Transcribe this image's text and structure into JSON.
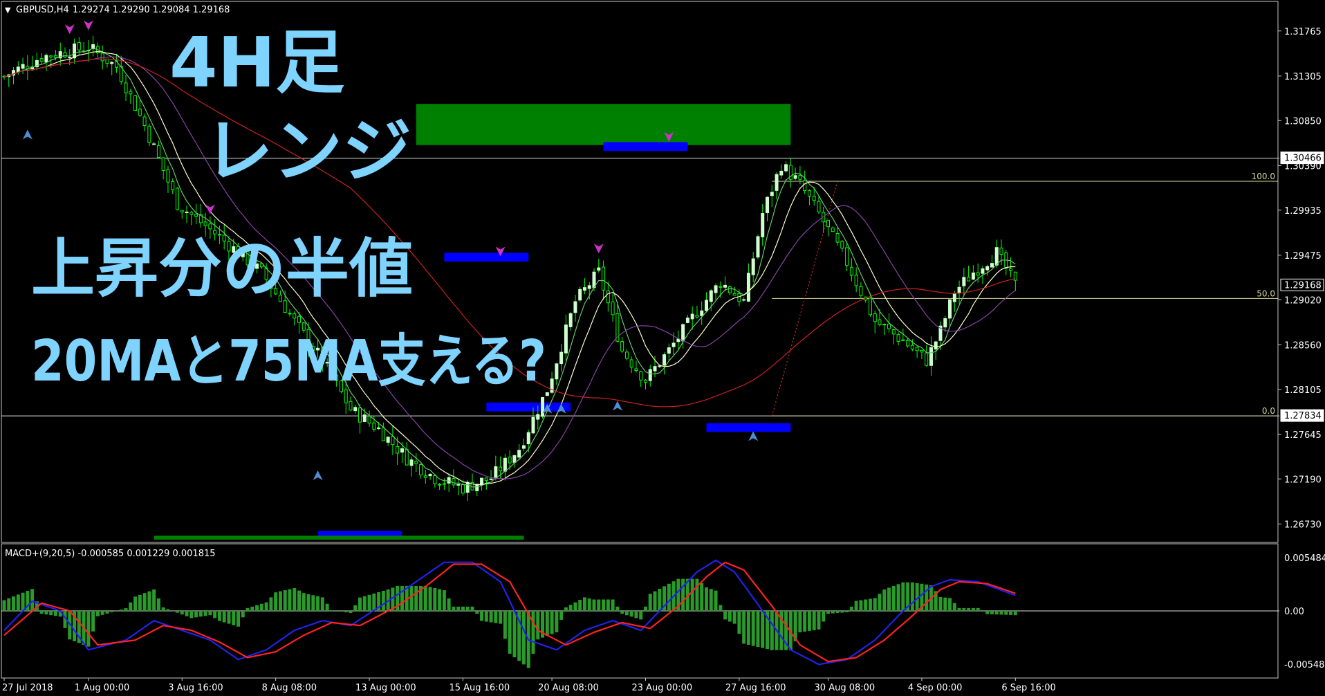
{
  "header": {
    "symbol_label": "GBPUSD,H4",
    "ohlc_label": "1.29274 1.29290 1.29084 1.29168"
  },
  "indicator": {
    "label": "MACD+(9,20,5) -0.000585 0.001229 0.001815"
  },
  "annotations": {
    "line1": "4H足",
    "line2": "レンジ",
    "line3": "上昇分の半値",
    "line4": "20MAと75MA支える?"
  },
  "price_axis": {
    "ticks": [
      "1.31765",
      "1.31305",
      "1.30850",
      "1.30390",
      "1.29935",
      "1.29475",
      "1.29020",
      "1.28560",
      "1.28105",
      "1.27645",
      "1.27190",
      "1.26730"
    ],
    "tags": [
      {
        "text": "1.30466",
        "kind": "hline"
      },
      {
        "text": "1.29168",
        "kind": "bid"
      },
      {
        "text": "1.27834",
        "kind": "hline"
      }
    ]
  },
  "macd_axis": {
    "ticks": [
      "0.005484",
      "0.00",
      "-0.005484"
    ]
  },
  "time_axis": {
    "ticks": [
      "27 Jul 2018",
      "1 Aug 00:00",
      "3 Aug 16:00",
      "8 Aug 08:00",
      "13 Aug 00:00",
      "15 Aug 16:00",
      "20 Aug 08:00",
      "23 Aug 00:00",
      "27 Aug 16:00",
      "30 Aug 08:00",
      "4 Sep 00:00",
      "6 Sep 16:00"
    ]
  },
  "fibo": {
    "levels": [
      {
        "label": "100.0",
        "price": 1.3023
      },
      {
        "label": "50.0",
        "price": 1.29033
      },
      {
        "label": "0.0",
        "price": 1.27834
      }
    ]
  },
  "horizontal_lines": [
    1.30466,
    1.27834
  ],
  "colors": {
    "background": "#000000",
    "bull_candle": "#ccffcc",
    "bear_candle": "#00ff00",
    "ma_fast": "#ffffcc",
    "ma_mid": "#66cc66",
    "ma_purple": "#8844aa",
    "ma_slow": "#cc2222",
    "macd_main": "#2222ee",
    "macd_signal": "#ff2222",
    "macd_hist": "#2a9a2a",
    "zone_green": "#008000",
    "zone_blue": "#0000ff",
    "annotation": "#7fd3ff",
    "arrow_up": "#4d8fd6",
    "arrow_down": "#cc33cc"
  },
  "chart_data": {
    "type": "candlestick",
    "symbol": "GBPUSD",
    "timeframe": "H4",
    "y_range": [
      1.2657,
      1.3194
    ],
    "macd_range": [
      -0.0059,
      0.0059
    ],
    "price_path": [
      [
        0,
        1.313
      ],
      [
        8,
        1.315
      ],
      [
        18,
        1.316
      ],
      [
        24,
        1.314
      ],
      [
        30,
        1.308
      ],
      [
        37,
        1.3
      ],
      [
        45,
        1.297
      ],
      [
        55,
        1.293
      ],
      [
        62,
        1.288
      ],
      [
        68,
        1.284
      ],
      [
        74,
        1.279
      ],
      [
        80,
        1.277
      ],
      [
        86,
        1.274
      ],
      [
        92,
        1.272
      ],
      [
        98,
        1.271
      ],
      [
        104,
        1.272
      ],
      [
        110,
        1.275
      ],
      [
        116,
        1.281
      ],
      [
        122,
        1.29
      ],
      [
        127,
        1.293
      ],
      [
        132,
        1.285
      ],
      [
        137,
        1.282
      ],
      [
        142,
        1.285
      ],
      [
        148,
        1.289
      ],
      [
        153,
        1.292
      ],
      [
        158,
        1.29
      ],
      [
        162,
        1.299
      ],
      [
        166,
        1.304
      ],
      [
        170,
        1.302
      ],
      [
        174,
        1.299
      ],
      [
        180,
        1.294
      ],
      [
        186,
        1.288
      ],
      [
        192,
        1.286
      ],
      [
        197,
        1.284
      ],
      [
        200,
        1.287
      ],
      [
        203,
        1.291
      ],
      [
        207,
        1.293
      ],
      [
        212,
        1.295
      ],
      [
        216,
        1.2917
      ]
    ],
    "macd_main_path": [
      [
        0,
        -0.002
      ],
      [
        6,
        0.001
      ],
      [
        12,
        0.0
      ],
      [
        18,
        -0.004
      ],
      [
        26,
        -0.003
      ],
      [
        32,
        -0.001
      ],
      [
        38,
        -0.002
      ],
      [
        44,
        -0.003
      ],
      [
        50,
        -0.005
      ],
      [
        56,
        -0.004
      ],
      [
        62,
        -0.002
      ],
      [
        68,
        -0.001
      ],
      [
        74,
        -0.0015
      ],
      [
        82,
        0.001
      ],
      [
        88,
        0.003
      ],
      [
        94,
        0.005
      ],
      [
        100,
        0.005
      ],
      [
        106,
        0.003
      ],
      [
        112,
        -0.003
      ],
      [
        118,
        -0.004
      ],
      [
        124,
        -0.002
      ],
      [
        130,
        -0.001
      ],
      [
        136,
        -0.002
      ],
      [
        142,
        0.001
      ],
      [
        148,
        0.004
      ],
      [
        152,
        0.0052
      ],
      [
        156,
        0.004
      ],
      [
        162,
        0.0
      ],
      [
        168,
        -0.004
      ],
      [
        174,
        -0.0055
      ],
      [
        180,
        -0.005
      ],
      [
        186,
        -0.003
      ],
      [
        192,
        0.0
      ],
      [
        198,
        0.0025
      ],
      [
        202,
        0.0032
      ],
      [
        208,
        0.003
      ],
      [
        216,
        0.0016
      ]
    ],
    "macd_signal_path": [
      [
        0,
        -0.0025
      ],
      [
        8,
        0.0008
      ],
      [
        14,
        0.0
      ],
      [
        20,
        -0.0035
      ],
      [
        28,
        -0.003
      ],
      [
        34,
        -0.0015
      ],
      [
        40,
        -0.002
      ],
      [
        46,
        -0.0032
      ],
      [
        52,
        -0.0048
      ],
      [
        58,
        -0.0042
      ],
      [
        64,
        -0.0025
      ],
      [
        70,
        -0.0012
      ],
      [
        76,
        -0.0015
      ],
      [
        84,
        0.0005
      ],
      [
        90,
        0.0025
      ],
      [
        96,
        0.0048
      ],
      [
        102,
        0.0048
      ],
      [
        108,
        0.003
      ],
      [
        114,
        -0.002
      ],
      [
        120,
        -0.0035
      ],
      [
        126,
        -0.0022
      ],
      [
        132,
        -0.0012
      ],
      [
        138,
        -0.0018
      ],
      [
        144,
        0.0005
      ],
      [
        150,
        0.0035
      ],
      [
        154,
        0.005
      ],
      [
        158,
        0.0042
      ],
      [
        164,
        0.0005
      ],
      [
        170,
        -0.0035
      ],
      [
        176,
        -0.0052
      ],
      [
        182,
        -0.0048
      ],
      [
        188,
        -0.003
      ],
      [
        194,
        -0.0005
      ],
      [
        200,
        0.0022
      ],
      [
        204,
        0.003
      ],
      [
        210,
        0.0028
      ],
      [
        216,
        0.0018
      ]
    ],
    "zones": [
      {
        "color": "green",
        "x0": 88,
        "x1": 168,
        "top": 1.3102,
        "bottom": 1.306
      },
      {
        "color": "blue",
        "x0": 128,
        "x1": 146,
        "top": 1.3063,
        "bottom": 1.3054
      },
      {
        "color": "blue",
        "x0": 94,
        "x1": 112,
        "top": 1.295,
        "bottom": 1.2941
      },
      {
        "color": "blue",
        "x0": 103,
        "x1": 121,
        "top": 1.2797,
        "bottom": 1.2788
      },
      {
        "color": "blue",
        "x0": 150,
        "x1": 168,
        "top": 1.2776,
        "bottom": 1.2767
      },
      {
        "color": "blue",
        "x0": 67,
        "x1": 85,
        "top": 1.2666,
        "bottom": 1.2657
      },
      {
        "color": "green",
        "x0": 32,
        "x1": 111,
        "top": 1.2661,
        "bottom": 1.2657
      }
    ],
    "arrows_up": [
      [
        5,
        1.307
      ],
      [
        67,
        1.2722
      ],
      [
        116,
        1.279
      ],
      [
        119,
        1.279
      ],
      [
        131,
        1.2793
      ],
      [
        160,
        1.2762
      ]
    ],
    "arrows_down": [
      [
        14,
        1.3179
      ],
      [
        18,
        1.3183
      ],
      [
        44,
        1.2995
      ],
      [
        106,
        1.2952
      ],
      [
        127,
        1.2955
      ],
      [
        142,
        1.3069
      ]
    ]
  }
}
